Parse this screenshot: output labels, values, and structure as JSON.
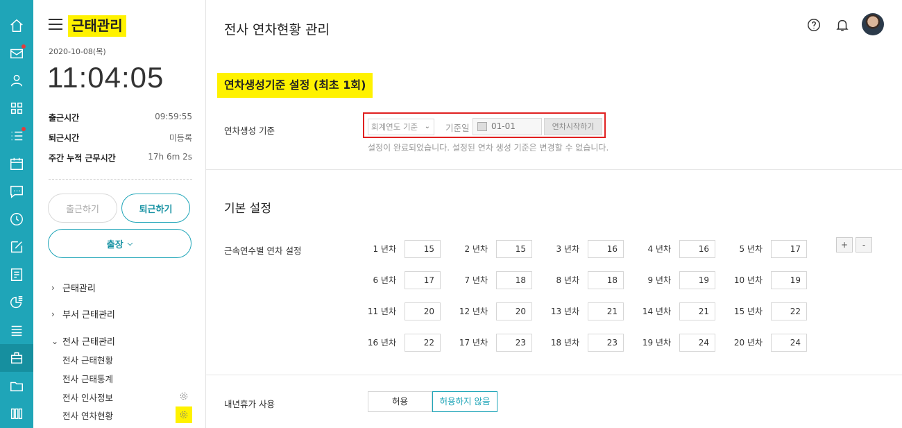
{
  "rail": {
    "accent": "#1fa5b8",
    "items": [
      {
        "icon": "home-icon"
      },
      {
        "icon": "mail-icon",
        "badge": true
      },
      {
        "icon": "user-icon"
      },
      {
        "icon": "apps-grid-icon"
      },
      {
        "icon": "list-icon",
        "badge": true
      },
      {
        "icon": "calendar-icon"
      },
      {
        "icon": "chat-icon"
      },
      {
        "icon": "clock-icon"
      },
      {
        "icon": "edit-icon"
      },
      {
        "icon": "report-icon"
      },
      {
        "icon": "pie-chart-icon"
      },
      {
        "icon": "stack-icon"
      },
      {
        "icon": "attendance-icon",
        "active": true
      },
      {
        "icon": "folder-icon"
      },
      {
        "icon": "library-icon"
      }
    ]
  },
  "panel": {
    "title": "근태관리",
    "date": "2020-10-08(목)",
    "clock": "11:04:05",
    "stats": [
      {
        "label": "출근시간",
        "value": "09:59:55"
      },
      {
        "label": "퇴근시간",
        "value": "미등록"
      },
      {
        "label": "주간 누적 근무시간",
        "value": "17h 6m 2s"
      }
    ],
    "btn_in": "출근하기",
    "btn_out": "퇴근하기",
    "btn_trip": "출장",
    "nav": [
      {
        "label": "근태관리",
        "arrow": ">"
      },
      {
        "label": "부서 근태관리",
        "arrow": ">"
      },
      {
        "label": "전사 근태관리",
        "arrow": "v"
      }
    ],
    "sub": [
      {
        "label": "전사 근태현황"
      },
      {
        "label": "전사 근태통계"
      },
      {
        "label": "전사 인사정보"
      },
      {
        "label": "전사 연차현황"
      }
    ]
  },
  "main": {
    "title": "전사 연차현황 관리",
    "section1": "연차생성기준 설정 (최초 1회)",
    "basis_label": "연차생성 기준",
    "basis_select": "회계연도 기준",
    "base_day_label": "기준일",
    "base_day_value": "01-01",
    "start_button": "연차시작하기",
    "notice": "설정이 완료되었습니다. 설정된 연차 생성 기준은 변경할 수 없습니다.",
    "section2": "기본 설정",
    "tenure_label": "근속연수별 연차 설정",
    "years": [
      {
        "label": "1 년차",
        "value": "15"
      },
      {
        "label": "2 년차",
        "value": "15"
      },
      {
        "label": "3 년차",
        "value": "16"
      },
      {
        "label": "4 년차",
        "value": "16"
      },
      {
        "label": "5 년차",
        "value": "17"
      },
      {
        "label": "6 년차",
        "value": "17"
      },
      {
        "label": "7 년차",
        "value": "18"
      },
      {
        "label": "8 년차",
        "value": "18"
      },
      {
        "label": "9 년차",
        "value": "19"
      },
      {
        "label": "10 년차",
        "value": "19"
      },
      {
        "label": "11 년차",
        "value": "20"
      },
      {
        "label": "12 년차",
        "value": "20"
      },
      {
        "label": "13 년차",
        "value": "21"
      },
      {
        "label": "14 년차",
        "value": "21"
      },
      {
        "label": "15 년차",
        "value": "22"
      },
      {
        "label": "16 년차",
        "value": "22"
      },
      {
        "label": "17 년차",
        "value": "23"
      },
      {
        "label": "18 년차",
        "value": "23"
      },
      {
        "label": "19 년차",
        "value": "24"
      },
      {
        "label": "20 년차",
        "value": "24"
      }
    ],
    "plus": "+",
    "minus": "-",
    "carryover_label": "내년휴가 사용",
    "allow": "허용",
    "disallow": "허용하지 않음"
  }
}
